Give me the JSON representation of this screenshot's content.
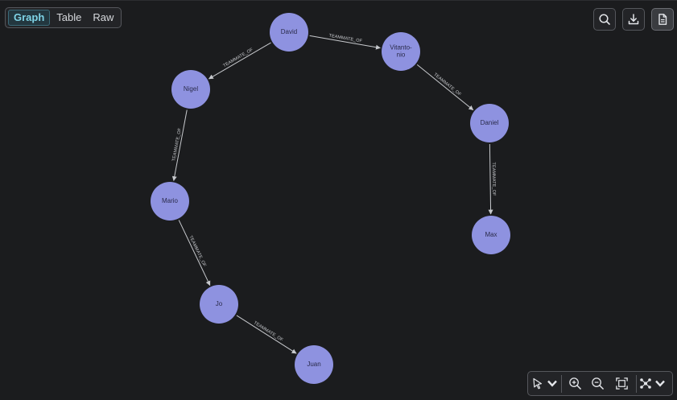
{
  "view_tabs": [
    {
      "label": "Graph",
      "active": true
    },
    {
      "label": "Table",
      "active": false
    },
    {
      "label": "Raw",
      "active": false
    }
  ],
  "top_actions": [
    {
      "icon": "search-icon"
    },
    {
      "icon": "download-icon"
    },
    {
      "icon": "document-icon",
      "active": true
    }
  ],
  "graph": {
    "node_color": "#8e92e0",
    "nodes": [
      {
        "id": "david",
        "label": "David"
      },
      {
        "id": "vitantonio",
        "label_lines": [
          "Vitanto-",
          "nio"
        ]
      },
      {
        "id": "nigel",
        "label": "Nigel"
      },
      {
        "id": "daniel",
        "label": "Daniel"
      },
      {
        "id": "mario",
        "label": "Mario"
      },
      {
        "id": "max",
        "label": "Max"
      },
      {
        "id": "jo",
        "label": "Jo"
      },
      {
        "id": "juan",
        "label": "Juan"
      }
    ],
    "edges": [
      {
        "from": "david",
        "to": "vitantonio",
        "label": "TEAMMATE_OF"
      },
      {
        "from": "david",
        "to": "nigel",
        "label": "TEAMMATE_OF"
      },
      {
        "from": "vitantonio",
        "to": "daniel",
        "label": "TEAMMATE_OF"
      },
      {
        "from": "nigel",
        "to": "mario",
        "label": "TEAMMATE_OF"
      },
      {
        "from": "daniel",
        "to": "max",
        "label": "TEAMMATE_OF"
      },
      {
        "from": "mario",
        "to": "jo",
        "label": "TEAMMATE_OF"
      },
      {
        "from": "jo",
        "to": "juan",
        "label": "TEAMMATE_OF"
      }
    ]
  },
  "bottom_toolbar": [
    {
      "icon": "pointer-icon",
      "has_dropdown": true
    },
    {
      "icon": "zoom-in-icon"
    },
    {
      "icon": "zoom-out-icon"
    },
    {
      "icon": "fit-screen-icon"
    },
    {
      "icon": "layout-icon",
      "has_dropdown": true
    }
  ]
}
